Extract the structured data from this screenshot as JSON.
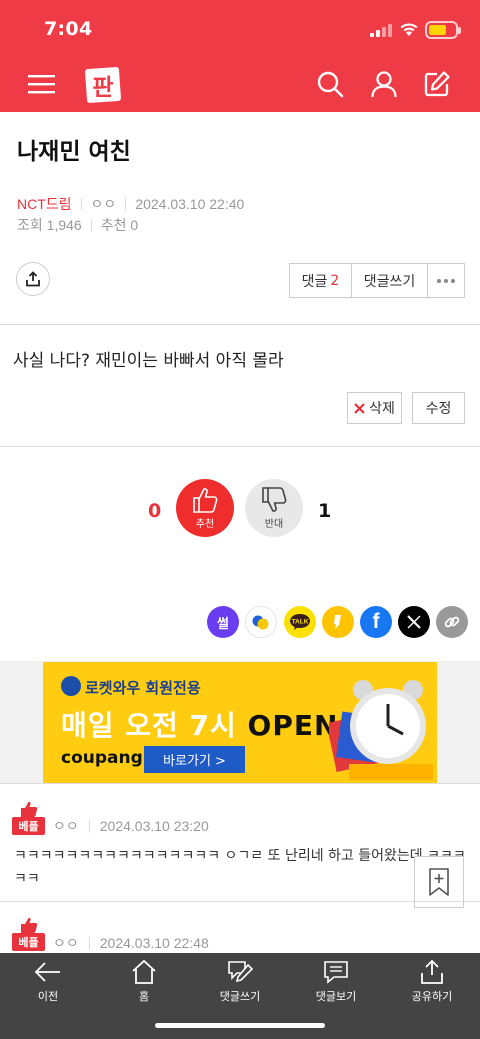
{
  "status_bar": {
    "time": "7:04"
  },
  "header": {
    "logo_text": "판",
    "icons": [
      "menu-icon",
      "search-icon",
      "user-icon",
      "write-icon"
    ]
  },
  "post": {
    "title": "나재민 여친",
    "category": "NCT드림",
    "author": "ㅇㅇ",
    "datetime": "2024.03.10 22:40",
    "views_label": "조회",
    "views": "1,946",
    "recommend_label": "추천",
    "recommend": "0",
    "comments_label": "댓글",
    "comments_count": "2",
    "write_comment_label": "댓글쓰기",
    "body": "사실 나다? 재민이는 바빠서 아직 몰라",
    "delete_label": "삭제",
    "edit_label": "수정"
  },
  "votes": {
    "up_count": "0",
    "up_label": "추천",
    "down_count": "1",
    "down_label": "반대"
  },
  "share_icons": [
    "ssul-icon",
    "nate-icon",
    "kakaotalk-icon",
    "kakaostory-icon",
    "facebook-icon",
    "x-icon",
    "link-icon"
  ],
  "ad": {
    "line1": "로켓와우 회원전용",
    "line2": "매일 오전 7시",
    "line2_highlight": "OPEN",
    "brand": "coupang",
    "cta": "바로가기 >"
  },
  "comments": [
    {
      "badge": "베플",
      "author": "ㅇㅇ",
      "datetime": "2024.03.10 23:20",
      "text": "ㅋㅋㅋㅋㅋㅋㅋㅋㅋㅋㅋㅋㅋㅋㅋㅋ ㅇㄱㄹ 또 난리네 하고 들어왔는데 ㅋㅋㅋㅋㅋ"
    },
    {
      "badge": "베플",
      "author": "ㅇㅇ",
      "datetime": "2024.03.10 22:48"
    }
  ],
  "bottom_nav": [
    {
      "label": "이전",
      "icon": "back-arrow-icon"
    },
    {
      "label": "홈",
      "icon": "home-icon"
    },
    {
      "label": "댓글쓰기",
      "icon": "write-comment-icon"
    },
    {
      "label": "댓글보기",
      "icon": "view-comments-icon"
    },
    {
      "label": "공유하기",
      "icon": "share-icon"
    }
  ],
  "colors": {
    "brand_red": "#ef3b45",
    "accent_red": "#e8333c",
    "bottom_bar": "#444444",
    "ad_yellow": "#ffcc11"
  }
}
